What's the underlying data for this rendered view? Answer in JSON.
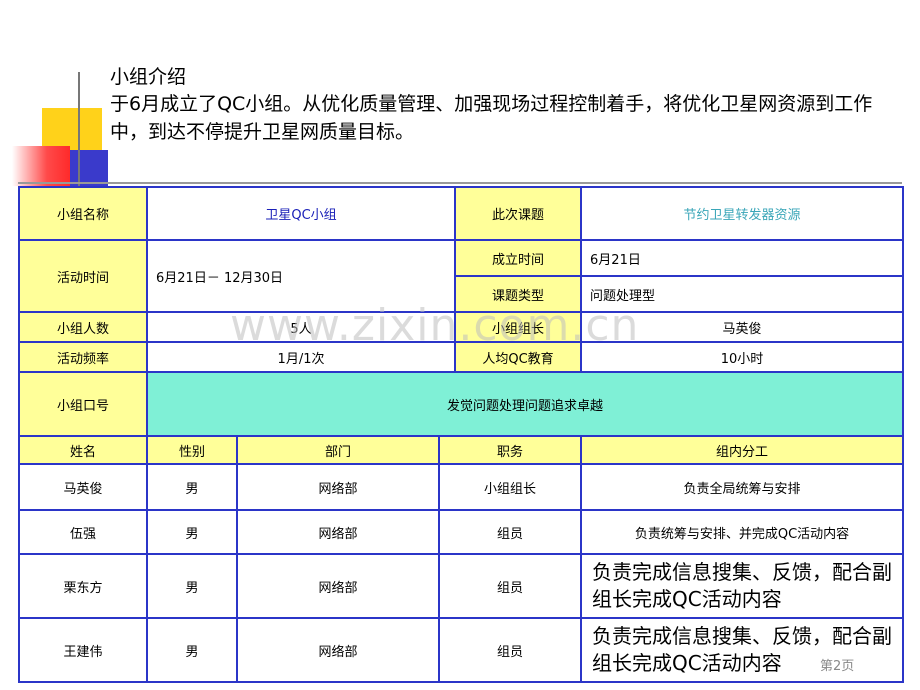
{
  "intro": {
    "title": "小组介绍",
    "text": " 于6月成立了QC小组。从优化质量管理、加强现场过程控制着手，将优化卫星网资源到工作中，到达不停提升卫星网质量目标。"
  },
  "info": {
    "group_name_label": "小组名称",
    "group_name": "卫星QC小组",
    "topic_label": "此次课题",
    "topic": "节约卫星转发器资源",
    "activity_time_label": "活动时间",
    "activity_time": "6月21日－ 12月30日",
    "founded_label": "成立时间",
    "founded": "6月21日",
    "topic_type_label": "课题类型",
    "topic_type": "问题处理型",
    "members_label": "小组人数",
    "members": "5人",
    "leader_label": "小组组长",
    "leader": "马英俊",
    "frequency_label": "活动频率",
    "frequency": "1月/1次",
    "education_label": "人均QC教育",
    "education": "10小时",
    "slogan_label": "小组口号",
    "slogan": "发觉问题处理问题追求卓越"
  },
  "members_table": {
    "headers": [
      "姓名",
      "性别",
      "部门",
      "职务",
      "组内分工"
    ],
    "rows": [
      [
        "马英俊",
        "男",
        "网络部",
        "小组组长",
        "负责全局统筹与安排"
      ],
      [
        "伍强",
        "男",
        "网络部",
        "组员",
        "负责统筹与安排、并完成QC活动内容"
      ],
      [
        "栗东方",
        "男",
        "网络部",
        "组员",
        "负责完成信息搜集、反馈，配合副组长完成QC活动内容"
      ],
      [
        "王建伟",
        "男",
        "网络部",
        "组员",
        "负责完成信息搜集、反馈，配合副组长完成QC活动内容"
      ]
    ]
  },
  "watermark": "www.zixin.com.cn",
  "page_number": "第2页",
  "colors": {
    "border": "#2b35c8",
    "label_bg": "#ffff99",
    "slogan_bg": "#7ff0d6",
    "title_text": "#1a20b8",
    "topic_text": "#3aa6b8"
  }
}
